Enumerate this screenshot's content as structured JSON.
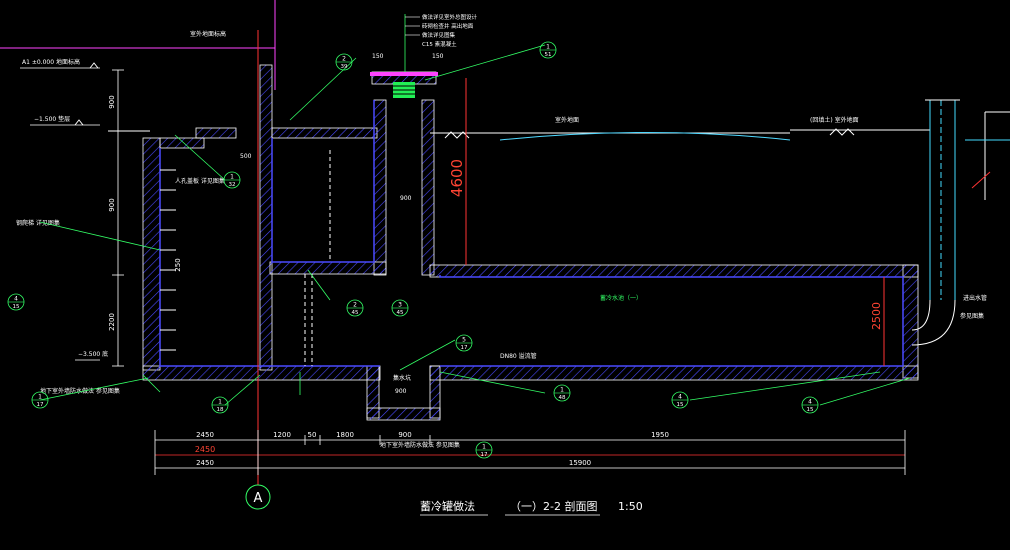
{
  "drawing": {
    "title": "蓄冷罐做法",
    "section": "（一）2-2 剖面图",
    "scale": "1:50",
    "axis_label": "A"
  },
  "dimensions": {
    "height_4600": "4600",
    "height_2500": "2500",
    "bottom_row1": [
      "2450",
      "1200",
      "50",
      "1800",
      "900",
      "1950"
    ],
    "bottom_row2": [
      "2450",
      "15900"
    ],
    "left_vertical": [
      "900",
      "900",
      "250",
      "2200"
    ],
    "small": [
      "500",
      "900",
      "150",
      "150",
      "900"
    ]
  },
  "labels": {
    "top_center": [
      "做法详见室外总图设计",
      "砖砌检查井 高出地面",
      "做法详见图集",
      "C15 素混凝土"
    ],
    "left_level1": "A1 ±0.000 地面标高",
    "left_level2": "−1.500 垫层",
    "left_level3": "−3.500 底",
    "left_top": "室外地面标高",
    "ground_left": "室外地面",
    "ground_right": "(回填土) 室外地面",
    "water_mark": "DN80 溢流管",
    "center_tank": "蓄冷水池（一）",
    "right_pipe": "进出水管",
    "right_note": "参见图集",
    "bottom_note": "地下室外墙防水做法 参见图集",
    "sump": "集水坑",
    "left_wall_note": "地下室外墙防水做法 参见图集",
    "left_detail": "钢爬梯 详见图集",
    "manhole": "人孔盖板 详见图集"
  },
  "callouts": [
    {
      "top": "2",
      "bottom": "39"
    },
    {
      "top": "1",
      "bottom": "51"
    },
    {
      "top": "1",
      "bottom": "32"
    },
    {
      "top": "2",
      "bottom": "45"
    },
    {
      "top": "3",
      "bottom": "45"
    },
    {
      "top": "5",
      "bottom": "17"
    },
    {
      "top": "1",
      "bottom": "48"
    },
    {
      "top": "1",
      "bottom": "17"
    },
    {
      "top": "4",
      "bottom": "15"
    },
    {
      "top": "4",
      "bottom": "15"
    },
    {
      "top": "4",
      "bottom": "15"
    },
    {
      "top": "1",
      "bottom": "18"
    },
    {
      "top": "1",
      "bottom": "17"
    }
  ],
  "colors": {
    "background": "#000000",
    "hatch": "#5a5aff",
    "wall_line": "#ffffff",
    "dim_red": "#ff3333",
    "callout_green": "#33ff66",
    "axis_green": "#33ff66",
    "magenta": "#ff44ff",
    "cyan": "#44ddff"
  }
}
